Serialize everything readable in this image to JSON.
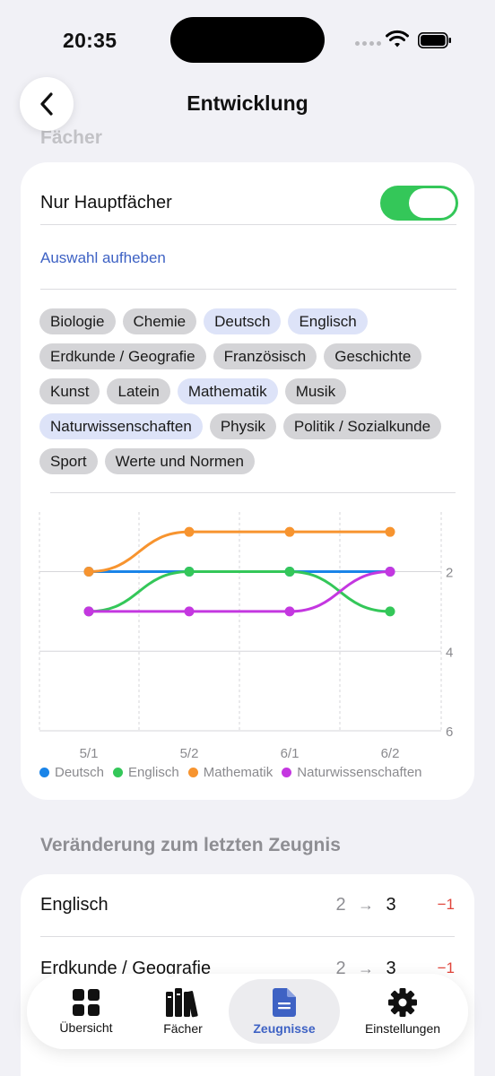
{
  "status": {
    "time": "20:35"
  },
  "nav": {
    "title": "Entwicklung"
  },
  "background": {
    "section_label": "Fächer"
  },
  "filter": {
    "toggle_label": "Nur Hauptfächer",
    "toggle_on": true,
    "clear_link": "Auswahl aufheben"
  },
  "subjects": [
    {
      "label": "Biologie",
      "selected": false
    },
    {
      "label": "Chemie",
      "selected": false
    },
    {
      "label": "Deutsch",
      "selected": true
    },
    {
      "label": "Englisch",
      "selected": true
    },
    {
      "label": "Erdkunde / Geografie",
      "selected": false
    },
    {
      "label": "Französisch",
      "selected": false
    },
    {
      "label": "Geschichte",
      "selected": false
    },
    {
      "label": "Kunst",
      "selected": false
    },
    {
      "label": "Latein",
      "selected": false
    },
    {
      "label": "Mathematik",
      "selected": true
    },
    {
      "label": "Musik",
      "selected": false
    },
    {
      "label": "Naturwissenschaften",
      "selected": true
    },
    {
      "label": "Physik",
      "selected": false
    },
    {
      "label": "Politik / Sozialkunde",
      "selected": false
    },
    {
      "label": "Sport",
      "selected": false
    },
    {
      "label": "Werte und Normen",
      "selected": false
    }
  ],
  "chart_data": {
    "type": "line",
    "categories": [
      "5/1",
      "5/2",
      "6/1",
      "6/2"
    ],
    "y_ticks": [
      "2",
      "4",
      "6"
    ],
    "y_tick_values": [
      2,
      4,
      6
    ],
    "ylim": [
      0.5,
      6
    ],
    "y_inverted": true,
    "legend_position": "bottom",
    "series": [
      {
        "name": "Deutsch",
        "color": "#1a84e8",
        "values": [
          2,
          2,
          2,
          2
        ]
      },
      {
        "name": "Englisch",
        "color": "#34c759",
        "values": [
          3,
          2,
          2,
          3
        ]
      },
      {
        "name": "Mathematik",
        "color": "#f7942f",
        "values": [
          2,
          1,
          1,
          1
        ]
      },
      {
        "name": "Naturwissenschaften",
        "color": "#c437e0",
        "values": [
          3,
          3,
          3,
          2
        ]
      }
    ]
  },
  "changes": {
    "title": "Veränderung zum letzten Zeugnis",
    "rows": [
      {
        "subject": "Englisch",
        "from": "2",
        "arrow": "→",
        "to": "3",
        "delta": "−1"
      },
      {
        "subject": "Erdkunde / Geografie",
        "from": "2",
        "arrow": "→",
        "to": "3",
        "delta": "−1"
      }
    ]
  },
  "tabs": [
    {
      "label": "Übersicht",
      "icon": "grid-icon",
      "active": false
    },
    {
      "label": "Fächer",
      "icon": "books-icon",
      "active": false
    },
    {
      "label": "Zeugnisse",
      "icon": "document-icon",
      "active": true
    },
    {
      "label": "Einstellungen",
      "icon": "gear-icon",
      "active": false
    }
  ]
}
